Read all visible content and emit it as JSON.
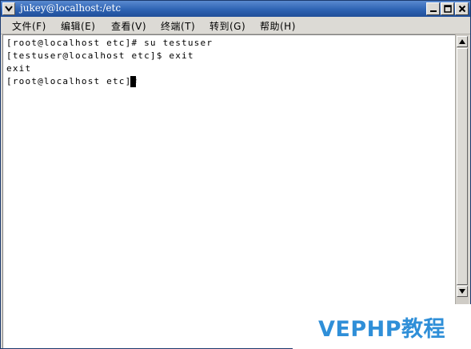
{
  "window": {
    "title": "jukey@localhost:/etc"
  },
  "menu": {
    "items": [
      {
        "label": "文件(F)",
        "icon": "file-menu"
      },
      {
        "label": "编辑(E)",
        "icon": "edit-menu"
      },
      {
        "label": "查看(V)",
        "icon": "view-menu"
      },
      {
        "label": "终端(T)",
        "icon": "terminal-menu"
      },
      {
        "label": "转到(G)",
        "icon": "goto-menu"
      },
      {
        "label": "帮助(H)",
        "icon": "help-menu"
      }
    ]
  },
  "terminal": {
    "lines": [
      "[root@localhost etc]# su testuser",
      "[testuser@localhost etc]$ exit",
      "exit",
      "[root@localhost etc]# "
    ]
  },
  "watermark": {
    "text": "VEPHP教程"
  },
  "colors": {
    "titlebar": "#2e63b3",
    "chrome": "#dcdad5",
    "terminal_bg": "#ffffff",
    "terminal_fg": "#000000",
    "watermark": "#2f8fd8"
  }
}
